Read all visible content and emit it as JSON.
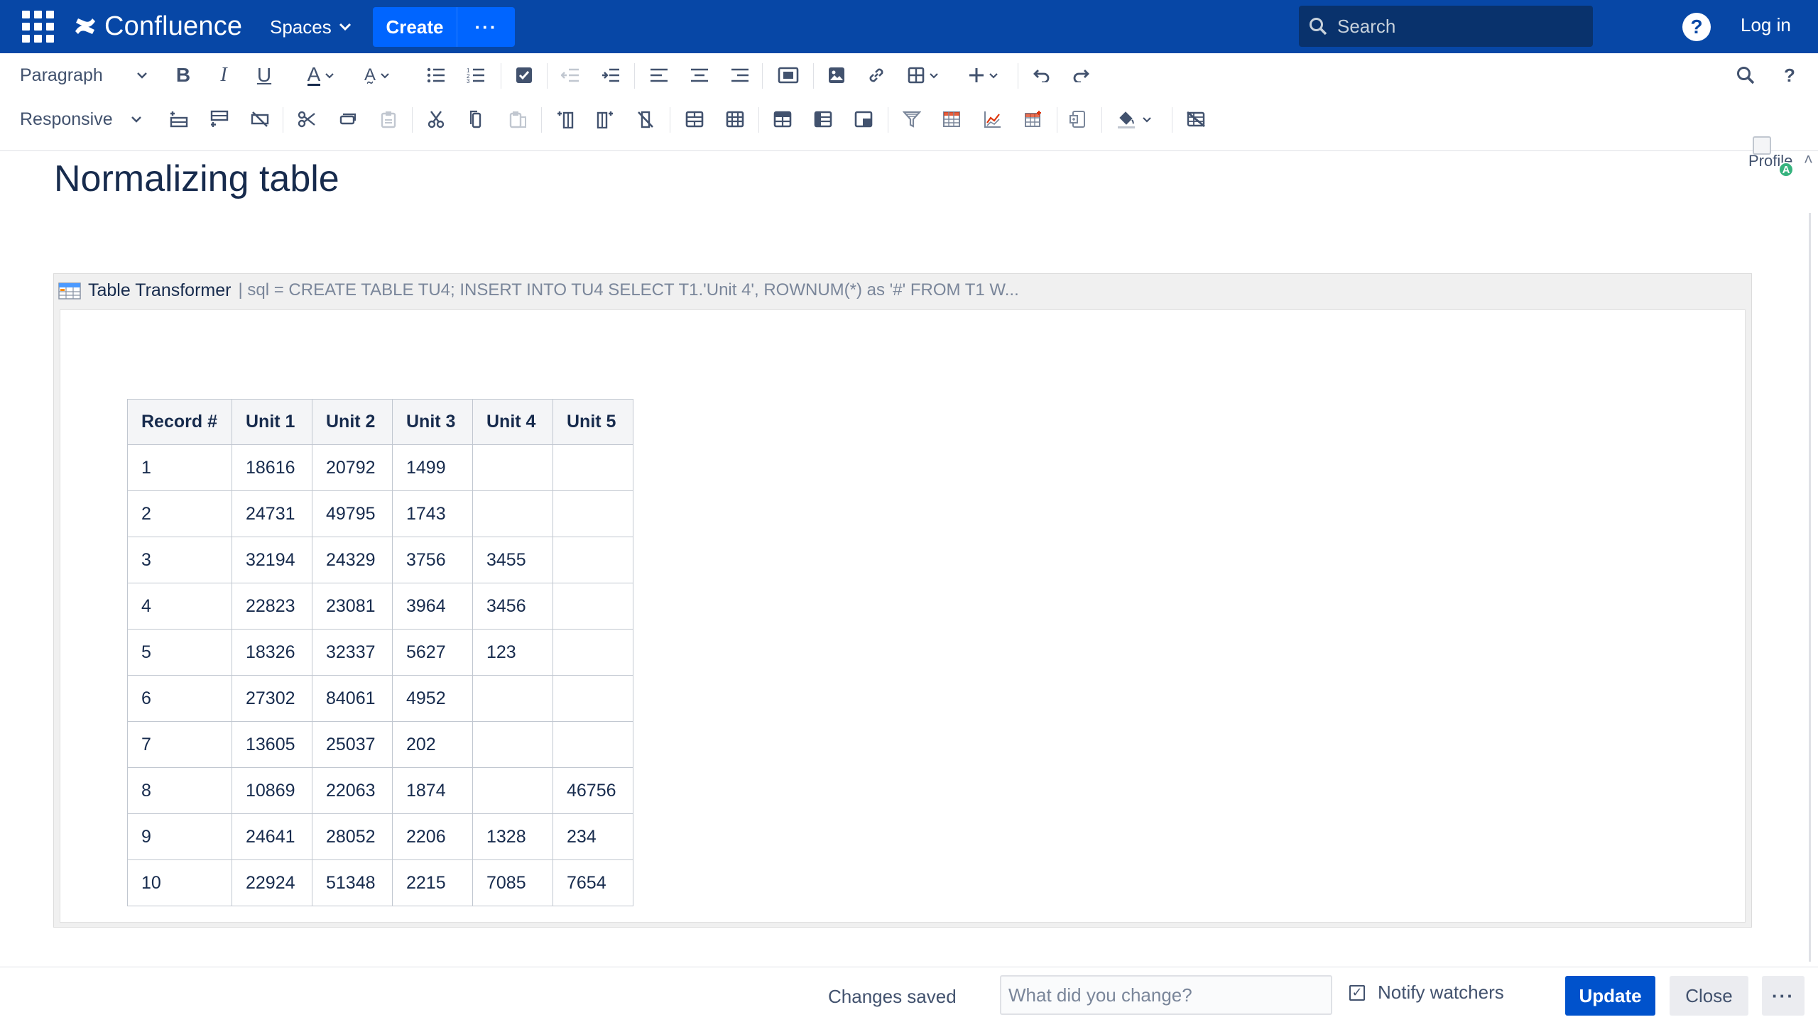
{
  "nav": {
    "logo_text": "Confluence",
    "spaces_label": "Spaces",
    "create_label": "Create",
    "more_label": "···",
    "search_placeholder": "Search",
    "help_label": "?",
    "login_label": "Log in"
  },
  "toolbar": {
    "paragraph_label": "Paragraph",
    "responsive_label": "Responsive"
  },
  "profile": {
    "alt_text": "Profile",
    "badge": "A"
  },
  "page": {
    "title": "Normalizing table"
  },
  "macro": {
    "name": "Table Transformer",
    "params": "| sql = CREATE TABLE TU4; INSERT INTO TU4  SELECT T1.'Unit 4', ROWNUM(*) as '#' FROM T1 W..."
  },
  "table": {
    "headers": [
      "Record #",
      "Unit 1",
      "Unit 2",
      "Unit 3",
      "Unit 4",
      "Unit 5"
    ],
    "rows": [
      [
        "1",
        "18616",
        "20792",
        "1499",
        "",
        ""
      ],
      [
        "2",
        "24731",
        "49795",
        "1743",
        "",
        ""
      ],
      [
        "3",
        "32194",
        "24329",
        "3756",
        "3455",
        ""
      ],
      [
        "4",
        "22823",
        "23081",
        "3964",
        "3456",
        ""
      ],
      [
        "5",
        "18326",
        "32337",
        "5627",
        "123",
        ""
      ],
      [
        "6",
        "27302",
        "84061",
        "4952",
        "",
        ""
      ],
      [
        "7",
        "13605",
        "25037",
        "202",
        "",
        ""
      ],
      [
        "8",
        "10869",
        "22063",
        "1874",
        "",
        "46756"
      ],
      [
        "9",
        "24641",
        "28052",
        "2206",
        "1328",
        "234"
      ],
      [
        "10",
        "22924",
        "51348",
        "2215",
        "7085",
        "7654"
      ]
    ]
  },
  "footer": {
    "status": "Changes saved",
    "change_placeholder": "What did you change?",
    "notify_label": "Notify watchers",
    "update_label": "Update",
    "close_label": "Close",
    "more_label": "···"
  },
  "colors": {
    "nav_bg": "#0747a6",
    "primary_button": "#0052cc",
    "create_button": "#0065ff"
  }
}
